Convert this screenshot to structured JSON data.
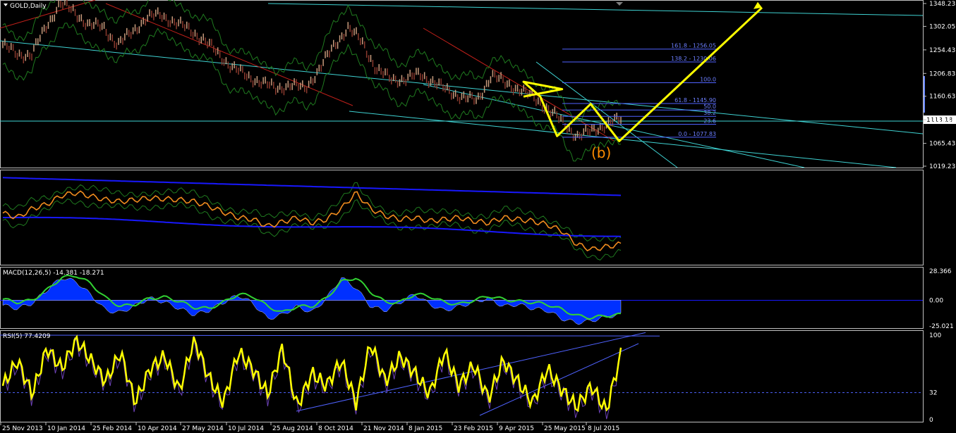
{
  "colors": {
    "background": "#000000",
    "grid_border": "#c0c0c0",
    "price_up": "#c89b7c",
    "price_down": "#8b3a2e",
    "channel_cyan": "#3fd3d3",
    "channel_red": "#c0201a",
    "bollinger": "#1f7a1f",
    "fib": "#4f62ff",
    "forecast": "#ffff00",
    "wave_label": "#ff8c00",
    "ma_blue": "#1818ff",
    "macd_hist": "#0030ff",
    "macd_signal": "#32d232",
    "rsi_line": "#ffff00",
    "rsi_sub": "#6d42b8"
  },
  "main_panel": {
    "symbol_label": "GOLD,Daily",
    "current_price": "1113.18",
    "wave_label": "(b)",
    "fib_levels": [
      {
        "label": "161.8 - 1256.05",
        "price": 1256.05
      },
      {
        "label": "138.2 - 1230.06",
        "price": 1230.06
      },
      {
        "label": "100.0",
        "price": 1188.0
      },
      {
        "label": "61.8 - 1145.90",
        "price": 1145.9
      },
      {
        "label": "50.0",
        "price": 1132.9
      },
      {
        "label": "38.2",
        "price": 1120.0
      },
      {
        "label": "23.6",
        "price": 1103.9
      },
      {
        "label": "0.0 - 1077.83",
        "price": 1077.83
      }
    ]
  },
  "macd_panel": {
    "label": "MACD(12,26,5) -14.381 -18.271",
    "axis_ticks": [
      "28.366",
      "0.00",
      "-25.021"
    ]
  },
  "rsi_panel": {
    "label": "RSI(5) 77.4209",
    "axis_ticks": [
      "100",
      "32",
      "0"
    ]
  },
  "chart_data": [
    {
      "type": "line",
      "title": "GOLD,Daily",
      "x": [
        "25 Nov 2013",
        "10 Jan 2014",
        "25 Feb 2014",
        "10 Apr 2014",
        "27 May 2014",
        "10 Jul 2014",
        "25 Aug 2014",
        "8 Oct 2014",
        "21 Nov 2014",
        "8 Jan 2015",
        "23 Feb 2015",
        "9 Apr 2015",
        "25 May 2015",
        "8 Jul 2015"
      ],
      "y_ticks": [
        "1348.23",
        "1302.05",
        "1254.43",
        "1206.83",
        "1160.63",
        "1113.18",
        "1065.43",
        "1019.23"
      ],
      "ylim": [
        1019.23,
        1348.23
      ],
      "series": [
        {
          "values": [
            1265,
            1245,
            1245,
            1300,
            1350,
            1330,
            1305,
            1300,
            1265,
            1290,
            1320,
            1325,
            1310,
            1295,
            1275,
            1245,
            1220,
            1200,
            1190,
            1175,
            1185,
            1175,
            1215,
            1260,
            1300,
            1270,
            1215,
            1195,
            1195,
            1205,
            1190,
            1170,
            1160,
            1150,
            1205,
            1185,
            1175,
            1155,
            1135,
            1105,
            1080,
            1090,
            1105,
            1113
          ]
        }
      ],
      "forecast_path": [
        [
          1205,
          1160
        ],
        [
          1228,
          1175
        ],
        [
          1205,
          1190
        ],
        [
          1215,
          1160
        ],
        [
          1225,
          1080
        ],
        [
          1245,
          1145
        ],
        [
          1262,
          1070
        ],
        [
          1347,
          1340
        ]
      ]
    },
    {
      "type": "line",
      "title": "",
      "series": [
        {
          "values": [
            0.55,
            0.5,
            0.6,
            0.65,
            0.75,
            0.78,
            0.74,
            0.7,
            0.68,
            0.7,
            0.72,
            0.71,
            0.7,
            0.68,
            0.63,
            0.56,
            0.5,
            0.48,
            0.4,
            0.45,
            0.5,
            0.44,
            0.48,
            0.6,
            0.78,
            0.6,
            0.52,
            0.48,
            0.5,
            0.46,
            0.48,
            0.5,
            0.46,
            0.44,
            0.5,
            0.48,
            0.46,
            0.42,
            0.35,
            0.2,
            0.14,
            0.17,
            0.2
          ]
        }
      ]
    },
    {
      "type": "area",
      "title": "MACD(12,26,5) -14.381 -18.271",
      "ylim": [
        -25.021,
        28.366
      ],
      "series": [
        {
          "values": [
            -5,
            -8,
            -3,
            10,
            22,
            18,
            5,
            -10,
            -12,
            -5,
            2,
            -2,
            -8,
            -14,
            -10,
            -2,
            5,
            -3,
            -18,
            -14,
            -6,
            -12,
            2,
            22,
            12,
            -6,
            -10,
            -2,
            6,
            -4,
            -10,
            -6,
            -2,
            2,
            -6,
            -4,
            -8,
            -10,
            -18,
            -22,
            -20,
            -16,
            -14
          ]
        },
        {
          "values": [
            -3,
            -6,
            -4,
            6,
            18,
            20,
            12,
            -2,
            -10,
            -8,
            -2,
            -1,
            -5,
            -11,
            -12,
            -6,
            2,
            0,
            -10,
            -16,
            -10,
            -10,
            -2,
            14,
            18,
            4,
            -6,
            -6,
            2,
            0,
            -6,
            -8,
            -4,
            0,
            -3,
            -5,
            -6,
            -8,
            -13,
            -19,
            -21,
            -19,
            -18
          ]
        }
      ]
    },
    {
      "type": "line",
      "title": "RSI(5) 77.4209",
      "ylim": [
        0,
        100
      ],
      "series": [
        {
          "values": [
            40,
            70,
            30,
            85,
            60,
            95,
            70,
            45,
            80,
            20,
            60,
            75,
            35,
            95,
            50,
            20,
            80,
            60,
            30,
            85,
            15,
            55,
            40,
            70,
            20,
            90,
            45,
            75,
            55,
            30,
            80,
            40,
            65,
            25,
            70,
            45,
            20,
            60,
            35,
            15,
            40,
            10,
            77
          ]
        }
      ]
    }
  ]
}
